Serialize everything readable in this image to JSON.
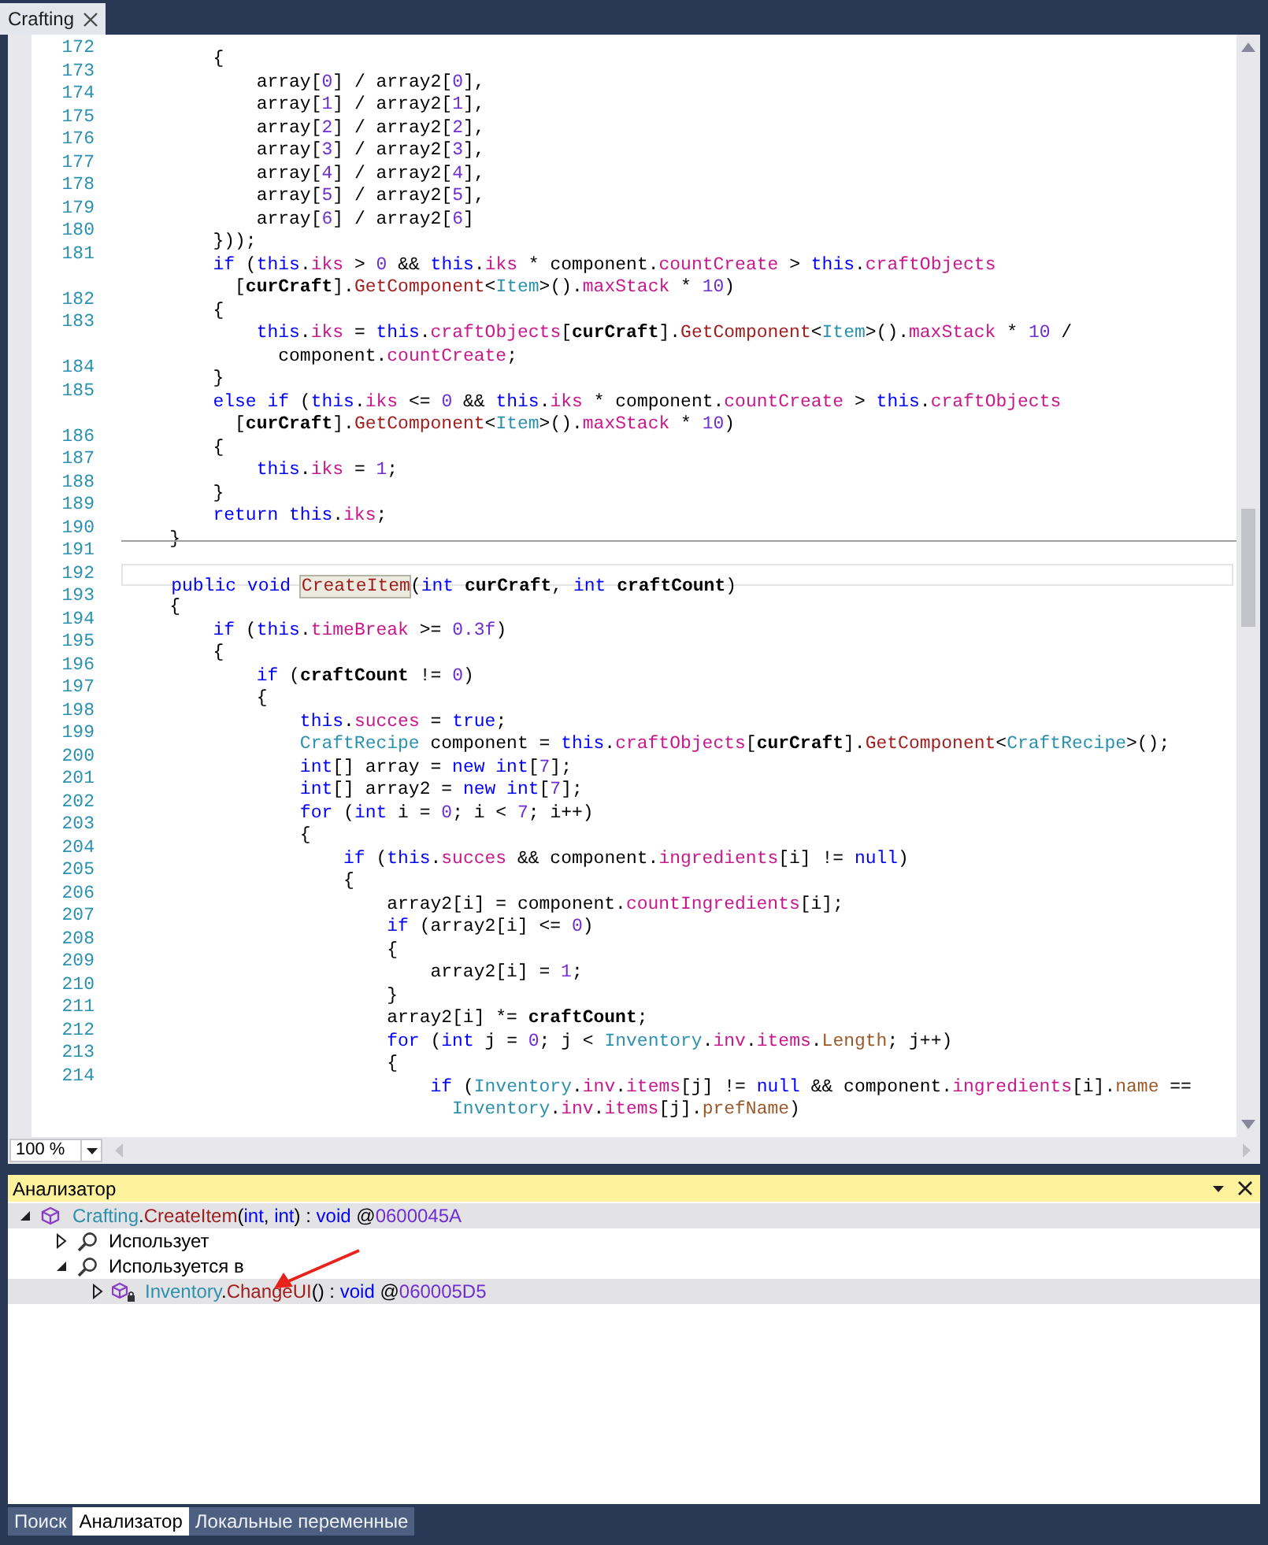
{
  "document_tab": {
    "title": "Crafting",
    "selected": true
  },
  "code_rows": [
    {
      "kind": "line",
      "number": "172",
      "tokens": [
        {
          "kind": "p",
          "text": "        {"
        }
      ]
    },
    {
      "kind": "line",
      "number": "173",
      "tokens": [
        {
          "kind": "p",
          "text": "            array["
        },
        {
          "kind": "num",
          "text": "0"
        },
        {
          "kind": "p",
          "text": "] / array2["
        },
        {
          "kind": "num",
          "text": "0"
        },
        {
          "kind": "p",
          "text": "],"
        }
      ]
    },
    {
      "kind": "line",
      "number": "174",
      "tokens": [
        {
          "kind": "p",
          "text": "            array["
        },
        {
          "kind": "num",
          "text": "1"
        },
        {
          "kind": "p",
          "text": "] / array2["
        },
        {
          "kind": "num",
          "text": "1"
        },
        {
          "kind": "p",
          "text": "],"
        }
      ]
    },
    {
      "kind": "line",
      "number": "175",
      "tokens": [
        {
          "kind": "p",
          "text": "            array["
        },
        {
          "kind": "num",
          "text": "2"
        },
        {
          "kind": "p",
          "text": "] / array2["
        },
        {
          "kind": "num",
          "text": "2"
        },
        {
          "kind": "p",
          "text": "],"
        }
      ]
    },
    {
      "kind": "line",
      "number": "176",
      "tokens": [
        {
          "kind": "p",
          "text": "            array["
        },
        {
          "kind": "num",
          "text": "3"
        },
        {
          "kind": "p",
          "text": "] / array2["
        },
        {
          "kind": "num",
          "text": "3"
        },
        {
          "kind": "p",
          "text": "],"
        }
      ]
    },
    {
      "kind": "line",
      "number": "177",
      "tokens": [
        {
          "kind": "p",
          "text": "            array["
        },
        {
          "kind": "num",
          "text": "4"
        },
        {
          "kind": "p",
          "text": "] / array2["
        },
        {
          "kind": "num",
          "text": "4"
        },
        {
          "kind": "p",
          "text": "],"
        }
      ]
    },
    {
      "kind": "line",
      "number": "178",
      "tokens": [
        {
          "kind": "p",
          "text": "            array["
        },
        {
          "kind": "num",
          "text": "5"
        },
        {
          "kind": "p",
          "text": "] / array2["
        },
        {
          "kind": "num",
          "text": "5"
        },
        {
          "kind": "p",
          "text": "],"
        }
      ]
    },
    {
      "kind": "line",
      "number": "179",
      "tokens": [
        {
          "kind": "p",
          "text": "            array["
        },
        {
          "kind": "num",
          "text": "6"
        },
        {
          "kind": "p",
          "text": "] / array2["
        },
        {
          "kind": "num",
          "text": "6"
        },
        {
          "kind": "p",
          "text": "]"
        }
      ]
    },
    {
      "kind": "line",
      "number": "180",
      "tokens": [
        {
          "kind": "p",
          "text": "        }));"
        }
      ]
    },
    {
      "kind": "line",
      "number": "181",
      "tokens": [
        {
          "kind": "kw",
          "text": "        if"
        },
        {
          "kind": "p",
          "text": " ("
        },
        {
          "kind": "kw",
          "text": "this"
        },
        {
          "kind": "p",
          "text": "."
        },
        {
          "kind": "field",
          "text": "iks"
        },
        {
          "kind": "p",
          "text": " > "
        },
        {
          "kind": "num",
          "text": "0"
        },
        {
          "kind": "p",
          "text": " && "
        },
        {
          "kind": "kw",
          "text": "this"
        },
        {
          "kind": "p",
          "text": "."
        },
        {
          "kind": "field",
          "text": "iks"
        },
        {
          "kind": "p",
          "text": " * component."
        },
        {
          "kind": "field",
          "text": "countCreate"
        },
        {
          "kind": "p",
          "text": " > "
        },
        {
          "kind": "kw",
          "text": "this"
        },
        {
          "kind": "p",
          "text": "."
        },
        {
          "kind": "field",
          "text": "craftObjects"
        }
      ]
    },
    {
      "kind": "continuation",
      "tokens": [
        {
          "kind": "p",
          "text": "          ["
        },
        {
          "kind": "param",
          "text": "curCraft"
        },
        {
          "kind": "p",
          "text": "]."
        },
        {
          "kind": "method",
          "text": "GetComponent"
        },
        {
          "kind": "p",
          "text": "<"
        },
        {
          "kind": "type",
          "text": "Item"
        },
        {
          "kind": "p",
          "text": ">()."
        },
        {
          "kind": "field",
          "text": "maxStack"
        },
        {
          "kind": "p",
          "text": " * "
        },
        {
          "kind": "num",
          "text": "10"
        },
        {
          "kind": "p",
          "text": ")"
        }
      ]
    },
    {
      "kind": "line",
      "number": "182",
      "tokens": [
        {
          "kind": "p",
          "text": "        {"
        }
      ]
    },
    {
      "kind": "line",
      "number": "183",
      "tokens": [
        {
          "kind": "kw",
          "text": "            this"
        },
        {
          "kind": "p",
          "text": "."
        },
        {
          "kind": "field",
          "text": "iks"
        },
        {
          "kind": "p",
          "text": " = "
        },
        {
          "kind": "kw",
          "text": "this"
        },
        {
          "kind": "p",
          "text": "."
        },
        {
          "kind": "field",
          "text": "craftObjects"
        },
        {
          "kind": "p",
          "text": "["
        },
        {
          "kind": "param",
          "text": "curCraft"
        },
        {
          "kind": "p",
          "text": "]."
        },
        {
          "kind": "method",
          "text": "GetComponent"
        },
        {
          "kind": "p",
          "text": "<"
        },
        {
          "kind": "type",
          "text": "Item"
        },
        {
          "kind": "p",
          "text": ">()."
        },
        {
          "kind": "field",
          "text": "maxStack"
        },
        {
          "kind": "p",
          "text": " * "
        },
        {
          "kind": "num",
          "text": "10"
        },
        {
          "kind": "p",
          "text": " /"
        }
      ]
    },
    {
      "kind": "continuation",
      "tokens": [
        {
          "kind": "p",
          "text": "              component."
        },
        {
          "kind": "field",
          "text": "countCreate"
        },
        {
          "kind": "p",
          "text": ";"
        }
      ]
    },
    {
      "kind": "line",
      "number": "184",
      "tokens": [
        {
          "kind": "p",
          "text": "        }"
        }
      ]
    },
    {
      "kind": "line",
      "number": "185",
      "tokens": [
        {
          "kind": "kw",
          "text": "        else if"
        },
        {
          "kind": "p",
          "text": " ("
        },
        {
          "kind": "kw",
          "text": "this"
        },
        {
          "kind": "p",
          "text": "."
        },
        {
          "kind": "field",
          "text": "iks"
        },
        {
          "kind": "p",
          "text": " <= "
        },
        {
          "kind": "num",
          "text": "0"
        },
        {
          "kind": "p",
          "text": " && "
        },
        {
          "kind": "kw",
          "text": "this"
        },
        {
          "kind": "p",
          "text": "."
        },
        {
          "kind": "field",
          "text": "iks"
        },
        {
          "kind": "p",
          "text": " * component."
        },
        {
          "kind": "field",
          "text": "countCreate"
        },
        {
          "kind": "p",
          "text": " > "
        },
        {
          "kind": "kw",
          "text": "this"
        },
        {
          "kind": "p",
          "text": "."
        },
        {
          "kind": "field",
          "text": "craftObjects"
        }
      ]
    },
    {
      "kind": "continuation",
      "tokens": [
        {
          "kind": "p",
          "text": "          ["
        },
        {
          "kind": "param",
          "text": "curCraft"
        },
        {
          "kind": "p",
          "text": "]."
        },
        {
          "kind": "method",
          "text": "GetComponent"
        },
        {
          "kind": "p",
          "text": "<"
        },
        {
          "kind": "type",
          "text": "Item"
        },
        {
          "kind": "p",
          "text": ">()."
        },
        {
          "kind": "field",
          "text": "maxStack"
        },
        {
          "kind": "p",
          "text": " * "
        },
        {
          "kind": "num",
          "text": "10"
        },
        {
          "kind": "p",
          "text": ")"
        }
      ]
    },
    {
      "kind": "line",
      "number": "186",
      "tokens": [
        {
          "kind": "p",
          "text": "        {"
        }
      ]
    },
    {
      "kind": "line",
      "number": "187",
      "tokens": [
        {
          "kind": "kw",
          "text": "            this"
        },
        {
          "kind": "p",
          "text": "."
        },
        {
          "kind": "field",
          "text": "iks"
        },
        {
          "kind": "p",
          "text": " = "
        },
        {
          "kind": "num",
          "text": "1"
        },
        {
          "kind": "p",
          "text": ";"
        }
      ]
    },
    {
      "kind": "line",
      "number": "188",
      "tokens": [
        {
          "kind": "p",
          "text": "        }"
        }
      ]
    },
    {
      "kind": "line",
      "number": "189",
      "tokens": [
        {
          "kind": "kw",
          "text": "        return this"
        },
        {
          "kind": "p",
          "text": "."
        },
        {
          "kind": "field",
          "text": "iks"
        },
        {
          "kind": "p",
          "text": ";"
        }
      ]
    },
    {
      "kind": "line",
      "number": "190",
      "tokens": [
        {
          "kind": "p",
          "text": "    }"
        }
      ]
    },
    {
      "kind": "separator",
      "number": "191",
      "tokens": []
    },
    {
      "kind": "current",
      "number": "192",
      "tokens": [
        {
          "kind": "kw",
          "text": "    public void "
        },
        {
          "kind": "method-marked",
          "text": "CreateItem"
        },
        {
          "kind": "p",
          "text": "("
        },
        {
          "kind": "kw",
          "text": "int "
        },
        {
          "kind": "param",
          "text": "curCraft"
        },
        {
          "kind": "p",
          "text": ", "
        },
        {
          "kind": "kw",
          "text": "int "
        },
        {
          "kind": "param",
          "text": "craftCount"
        },
        {
          "kind": "p",
          "text": ")"
        }
      ]
    },
    {
      "kind": "line",
      "number": "193",
      "tokens": [
        {
          "kind": "p",
          "text": "    {"
        }
      ]
    },
    {
      "kind": "line",
      "number": "194",
      "tokens": [
        {
          "kind": "kw",
          "text": "        if"
        },
        {
          "kind": "p",
          "text": " ("
        },
        {
          "kind": "kw",
          "text": "this"
        },
        {
          "kind": "p",
          "text": "."
        },
        {
          "kind": "field",
          "text": "timeBreak"
        },
        {
          "kind": "p",
          "text": " >= "
        },
        {
          "kind": "num",
          "text": "0.3f"
        },
        {
          "kind": "p",
          "text": ")"
        }
      ]
    },
    {
      "kind": "line",
      "number": "195",
      "tokens": [
        {
          "kind": "p",
          "text": "        {"
        }
      ]
    },
    {
      "kind": "line",
      "number": "196",
      "tokens": [
        {
          "kind": "kw",
          "text": "            if"
        },
        {
          "kind": "p",
          "text": " ("
        },
        {
          "kind": "param",
          "text": "craftCount"
        },
        {
          "kind": "p",
          "text": " != "
        },
        {
          "kind": "num",
          "text": "0"
        },
        {
          "kind": "p",
          "text": ")"
        }
      ]
    },
    {
      "kind": "line",
      "number": "197",
      "tokens": [
        {
          "kind": "p",
          "text": "            {"
        }
      ]
    },
    {
      "kind": "line",
      "number": "198",
      "tokens": [
        {
          "kind": "kw",
          "text": "                this"
        },
        {
          "kind": "p",
          "text": "."
        },
        {
          "kind": "field",
          "text": "succes"
        },
        {
          "kind": "p",
          "text": " = "
        },
        {
          "kind": "kw",
          "text": "true"
        },
        {
          "kind": "p",
          "text": ";"
        }
      ]
    },
    {
      "kind": "line",
      "number": "199",
      "tokens": [
        {
          "kind": "type",
          "text": "                CraftRecipe"
        },
        {
          "kind": "p",
          "text": " component = "
        },
        {
          "kind": "kw",
          "text": "this"
        },
        {
          "kind": "p",
          "text": "."
        },
        {
          "kind": "field",
          "text": "craftObjects"
        },
        {
          "kind": "p",
          "text": "["
        },
        {
          "kind": "param",
          "text": "curCraft"
        },
        {
          "kind": "p",
          "text": "]."
        },
        {
          "kind": "method",
          "text": "GetComponent"
        },
        {
          "kind": "p",
          "text": "<"
        },
        {
          "kind": "type",
          "text": "CraftRecipe"
        },
        {
          "kind": "p",
          "text": ">();"
        }
      ]
    },
    {
      "kind": "line",
      "number": "200",
      "tokens": [
        {
          "kind": "kw",
          "text": "                int"
        },
        {
          "kind": "p",
          "text": "[] array = "
        },
        {
          "kind": "kw",
          "text": "new int"
        },
        {
          "kind": "p",
          "text": "["
        },
        {
          "kind": "num",
          "text": "7"
        },
        {
          "kind": "p",
          "text": "];"
        }
      ]
    },
    {
      "kind": "line",
      "number": "201",
      "tokens": [
        {
          "kind": "kw",
          "text": "                int"
        },
        {
          "kind": "p",
          "text": "[] array2 = "
        },
        {
          "kind": "kw",
          "text": "new int"
        },
        {
          "kind": "p",
          "text": "["
        },
        {
          "kind": "num",
          "text": "7"
        },
        {
          "kind": "p",
          "text": "];"
        }
      ]
    },
    {
      "kind": "line",
      "number": "202",
      "tokens": [
        {
          "kind": "kw",
          "text": "                for"
        },
        {
          "kind": "p",
          "text": " ("
        },
        {
          "kind": "kw",
          "text": "int"
        },
        {
          "kind": "p",
          "text": " i = "
        },
        {
          "kind": "num",
          "text": "0"
        },
        {
          "kind": "p",
          "text": "; i < "
        },
        {
          "kind": "num",
          "text": "7"
        },
        {
          "kind": "p",
          "text": "; i++)"
        }
      ]
    },
    {
      "kind": "line",
      "number": "203",
      "tokens": [
        {
          "kind": "p",
          "text": "                {"
        }
      ]
    },
    {
      "kind": "line",
      "number": "204",
      "tokens": [
        {
          "kind": "kw",
          "text": "                    if"
        },
        {
          "kind": "p",
          "text": " ("
        },
        {
          "kind": "kw",
          "text": "this"
        },
        {
          "kind": "p",
          "text": "."
        },
        {
          "kind": "field",
          "text": "succes"
        },
        {
          "kind": "p",
          "text": " && component."
        },
        {
          "kind": "field",
          "text": "ingredients"
        },
        {
          "kind": "p",
          "text": "[i] != "
        },
        {
          "kind": "kw",
          "text": "null"
        },
        {
          "kind": "p",
          "text": ")"
        }
      ]
    },
    {
      "kind": "line",
      "number": "205",
      "tokens": [
        {
          "kind": "p",
          "text": "                    {"
        }
      ]
    },
    {
      "kind": "line",
      "number": "206",
      "tokens": [
        {
          "kind": "p",
          "text": "                        array2[i] = component."
        },
        {
          "kind": "field",
          "text": "countIngredients"
        },
        {
          "kind": "p",
          "text": "[i];"
        }
      ]
    },
    {
      "kind": "line",
      "number": "207",
      "tokens": [
        {
          "kind": "kw",
          "text": "                        if"
        },
        {
          "kind": "p",
          "text": " (array2[i] <= "
        },
        {
          "kind": "num",
          "text": "0"
        },
        {
          "kind": "p",
          "text": ")"
        }
      ]
    },
    {
      "kind": "line",
      "number": "208",
      "tokens": [
        {
          "kind": "p",
          "text": "                        {"
        }
      ]
    },
    {
      "kind": "line",
      "number": "209",
      "tokens": [
        {
          "kind": "p",
          "text": "                            array2[i] = "
        },
        {
          "kind": "num",
          "text": "1"
        },
        {
          "kind": "p",
          "text": ";"
        }
      ]
    },
    {
      "kind": "line",
      "number": "210",
      "tokens": [
        {
          "kind": "p",
          "text": "                        }"
        }
      ]
    },
    {
      "kind": "line",
      "number": "211",
      "tokens": [
        {
          "kind": "p",
          "text": "                        array2[i] *= "
        },
        {
          "kind": "param",
          "text": "craftCount"
        },
        {
          "kind": "p",
          "text": ";"
        }
      ]
    },
    {
      "kind": "line",
      "number": "212",
      "tokens": [
        {
          "kind": "kw",
          "text": "                        for"
        },
        {
          "kind": "p",
          "text": " ("
        },
        {
          "kind": "kw",
          "text": "int"
        },
        {
          "kind": "p",
          "text": " j = "
        },
        {
          "kind": "num",
          "text": "0"
        },
        {
          "kind": "p",
          "text": "; j < "
        },
        {
          "kind": "type",
          "text": "Inventory"
        },
        {
          "kind": "p",
          "text": "."
        },
        {
          "kind": "field",
          "text": "inv"
        },
        {
          "kind": "p",
          "text": "."
        },
        {
          "kind": "field",
          "text": "items"
        },
        {
          "kind": "p",
          "text": "."
        },
        {
          "kind": "prop",
          "text": "Length"
        },
        {
          "kind": "p",
          "text": "; j++)"
        }
      ]
    },
    {
      "kind": "line",
      "number": "213",
      "tokens": [
        {
          "kind": "p",
          "text": "                        {"
        }
      ]
    },
    {
      "kind": "line",
      "number": "214",
      "tokens": [
        {
          "kind": "kw",
          "text": "                            if"
        },
        {
          "kind": "p",
          "text": " ("
        },
        {
          "kind": "type",
          "text": "Inventory"
        },
        {
          "kind": "p",
          "text": "."
        },
        {
          "kind": "field",
          "text": "inv"
        },
        {
          "kind": "p",
          "text": "."
        },
        {
          "kind": "field",
          "text": "items"
        },
        {
          "kind": "p",
          "text": "[j] != "
        },
        {
          "kind": "kw",
          "text": "null"
        },
        {
          "kind": "p",
          "text": " && component."
        },
        {
          "kind": "field",
          "text": "ingredients"
        },
        {
          "kind": "p",
          "text": "[i]."
        },
        {
          "kind": "prop",
          "text": "name"
        },
        {
          "kind": "p",
          "text": " =="
        }
      ]
    },
    {
      "kind": "continuation",
      "tokens": [
        {
          "kind": "type",
          "text": "                              Inventory"
        },
        {
          "kind": "p",
          "text": "."
        },
        {
          "kind": "field",
          "text": "inv"
        },
        {
          "kind": "p",
          "text": "."
        },
        {
          "kind": "field",
          "text": "items"
        },
        {
          "kind": "p",
          "text": "[j]."
        },
        {
          "kind": "prop",
          "text": "prefName"
        },
        {
          "kind": "p",
          "text": ")"
        }
      ]
    }
  ],
  "zoom": "100 %",
  "analyzer": {
    "title": "Анализатор",
    "tree": [
      {
        "kind": "method",
        "expanded": true,
        "highlighted": true,
        "tokens": [
          {
            "kind": "type",
            "text": "Crafting"
          },
          {
            "kind": "p",
            "text": "."
          },
          {
            "kind": "method",
            "text": "CreateItem"
          },
          {
            "kind": "p",
            "text": "("
          },
          {
            "kind": "kw",
            "text": "int"
          },
          {
            "kind": "p",
            "text": ", "
          },
          {
            "kind": "kw",
            "text": "int"
          },
          {
            "kind": "p",
            "text": ") : "
          },
          {
            "kind": "kw",
            "text": "void"
          },
          {
            "kind": "p",
            "text": " @"
          },
          {
            "kind": "num",
            "text": "0600045A"
          }
        ],
        "children": [
          {
            "kind": "search",
            "expanded": false,
            "highlighted": false,
            "tokens": [
              {
                "kind": "p",
                "text": "Использует"
              }
            ]
          },
          {
            "kind": "search",
            "expanded": true,
            "highlighted": false,
            "tokens": [
              {
                "kind": "p",
                "text": "Используется в"
              }
            ],
            "children": [
              {
                "kind": "method-locked",
                "expanded": false,
                "highlighted": true,
                "tokens": [
                  {
                    "kind": "type",
                    "text": "Inventory"
                  },
                  {
                    "kind": "p",
                    "text": "."
                  },
                  {
                    "kind": "method",
                    "text": "ChangeUI"
                  },
                  {
                    "kind": "p",
                    "text": "() : "
                  },
                  {
                    "kind": "kw",
                    "text": "void"
                  },
                  {
                    "kind": "p",
                    "text": " @"
                  },
                  {
                    "kind": "num",
                    "text": "060005D5"
                  }
                ]
              }
            ]
          }
        ]
      }
    ]
  },
  "bottom_tabs": [
    {
      "label": "Поиск",
      "selected": false
    },
    {
      "label": "Анализатор",
      "selected": true
    },
    {
      "label": "Локальные переменные",
      "selected": false
    }
  ]
}
